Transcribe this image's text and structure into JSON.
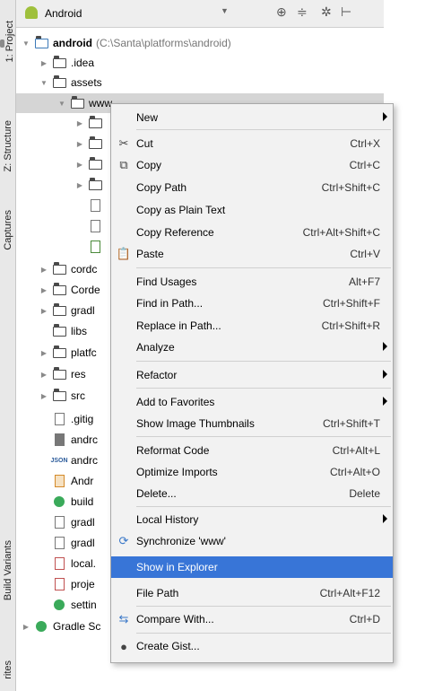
{
  "side_tabs": [
    {
      "label": "1: Project"
    },
    {
      "label": "Z: Structure"
    },
    {
      "label": "Captures"
    },
    {
      "label": "Build Variants"
    },
    {
      "label": "rites"
    }
  ],
  "toolbar": {
    "view_select": "Android"
  },
  "tree": {
    "root_name": "android",
    "root_path": "(C:\\Santa\\platforms\\android)",
    "rows": [
      {
        "label": ".idea"
      },
      {
        "label": "assets"
      },
      {
        "label": "www"
      },
      {
        "label": "cordc"
      },
      {
        "label": "Corde"
      },
      {
        "label": "gradl"
      },
      {
        "label": "libs"
      },
      {
        "label": "platfc"
      },
      {
        "label": "res"
      },
      {
        "label": "src"
      },
      {
        "label": ".gitig"
      },
      {
        "label": "andrc"
      },
      {
        "label": "andrc"
      },
      {
        "label": "Andr"
      },
      {
        "label": "build"
      },
      {
        "label": "gradl"
      },
      {
        "label": "gradl"
      },
      {
        "label": "local."
      },
      {
        "label": "proje"
      },
      {
        "label": "settin"
      },
      {
        "label": "Gradle Sc"
      }
    ]
  },
  "menu": {
    "items": [
      {
        "label": "New",
        "shortcut": ""
      },
      {
        "label": "Cut",
        "shortcut": "Ctrl+X"
      },
      {
        "label": "Copy",
        "shortcut": "Ctrl+C"
      },
      {
        "label": "Copy Path",
        "shortcut": "Ctrl+Shift+C"
      },
      {
        "label": "Copy as Plain Text",
        "shortcut": ""
      },
      {
        "label": "Copy Reference",
        "shortcut": "Ctrl+Alt+Shift+C"
      },
      {
        "label": "Paste",
        "shortcut": "Ctrl+V"
      },
      {
        "label": "Find Usages",
        "shortcut": "Alt+F7"
      },
      {
        "label": "Find in Path...",
        "shortcut": "Ctrl+Shift+F"
      },
      {
        "label": "Replace in Path...",
        "shortcut": "Ctrl+Shift+R"
      },
      {
        "label": "Analyze",
        "shortcut": ""
      },
      {
        "label": "Refactor",
        "shortcut": ""
      },
      {
        "label": "Add to Favorites",
        "shortcut": ""
      },
      {
        "label": "Show Image Thumbnails",
        "shortcut": "Ctrl+Shift+T"
      },
      {
        "label": "Reformat Code",
        "shortcut": "Ctrl+Alt+L"
      },
      {
        "label": "Optimize Imports",
        "shortcut": "Ctrl+Alt+O"
      },
      {
        "label": "Delete...",
        "shortcut": "Delete"
      },
      {
        "label": "Local History",
        "shortcut": ""
      },
      {
        "label": "Synchronize 'www'",
        "shortcut": ""
      },
      {
        "label": "Show in Explorer",
        "shortcut": ""
      },
      {
        "label": "File Path",
        "shortcut": "Ctrl+Alt+F12"
      },
      {
        "label": "Compare With...",
        "shortcut": "Ctrl+D"
      },
      {
        "label": "Create Gist...",
        "shortcut": ""
      }
    ]
  },
  "colors": {
    "highlight": "#3875d7",
    "folder": "#4a4a4a",
    "android": "#9fc03c"
  }
}
